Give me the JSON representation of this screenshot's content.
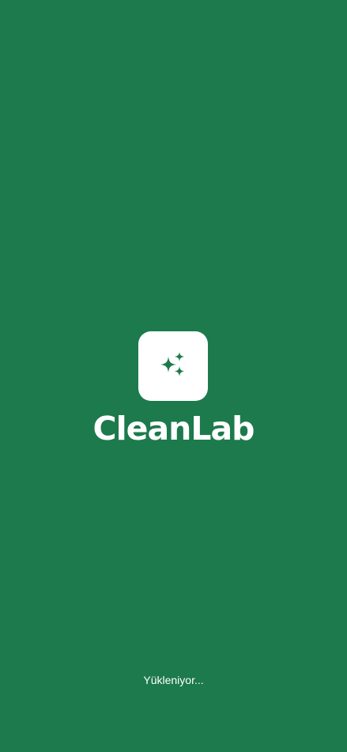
{
  "app": {
    "name": "CleanLab",
    "logo_icon": "sparkles-icon"
  },
  "status": {
    "loading_text": "Yükleniyor..."
  },
  "colors": {
    "background": "#1c7a4c",
    "logo_box": "#ffffff",
    "icon": "#1c7a4c",
    "text": "#ffffff"
  }
}
